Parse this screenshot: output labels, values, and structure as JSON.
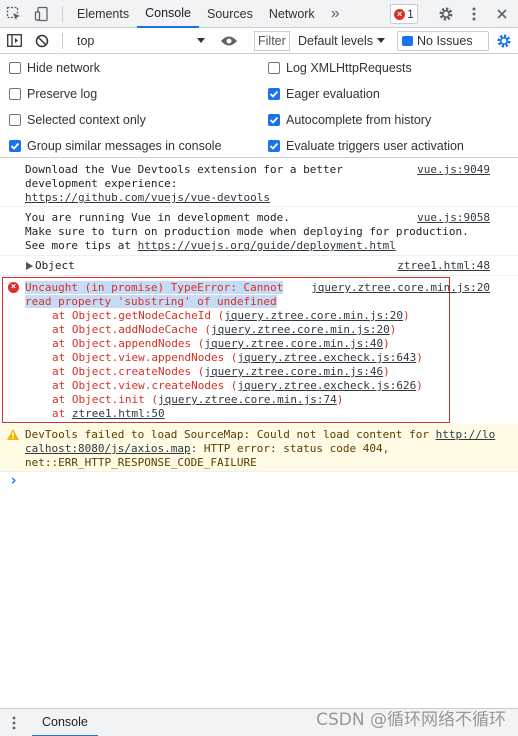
{
  "tabbar": {
    "tabs": [
      "Elements",
      "Console",
      "Sources",
      "Network"
    ],
    "more": "»",
    "error_count": "1"
  },
  "toolbar": {
    "context": "top",
    "filter_placeholder": "Filter",
    "levels": "Default levels",
    "issues": "No Issues"
  },
  "settings": {
    "hide_network": "Hide network",
    "preserve_log": "Preserve log",
    "selected_context": "Selected context only",
    "group_similar": "Group similar messages in console",
    "log_xhr": "Log XMLHttpRequests",
    "eager_eval": "Eager evaluation",
    "autocomplete": "Autocomplete from history",
    "eval_triggers": "Evaluate triggers user activation"
  },
  "messages": {
    "m1": {
      "line1": "Download the Vue Devtools extension for a better",
      "line2": "development experience:",
      "link": "https://github.com/vuejs/vue-devtools",
      "source": "vue.js:9049"
    },
    "m2": {
      "line1": "You are running Vue in development mode.",
      "line2": "Make sure to turn on production mode when deploying for production.",
      "line3_prefix": "See more tips at ",
      "link": "https://vuejs.org/guide/deployment.html",
      "source": "vue.js:9058"
    },
    "m3": {
      "text": "Object",
      "source": "ztree1.html:48"
    },
    "err": {
      "line1": "Uncaught (in promise) TypeError: Cannot",
      "line2": "read property 'substring' of undefined",
      "source": "jquery.ztree.core.min.js:20",
      "stack": [
        {
          "fn": "at Object.getNodeCacheId (",
          "loc": "jquery.ztree.core.min.js:20",
          "end": ")"
        },
        {
          "fn": "at Object.addNodeCache (",
          "loc": "jquery.ztree.core.min.js:20",
          "end": ")"
        },
        {
          "fn": "at Object.appendNodes (",
          "loc": "jquery.ztree.core.min.js:40",
          "end": ")"
        },
        {
          "fn": "at Object.view.appendNodes (",
          "loc": "jquery.ztree.excheck.js:643",
          "end": ")"
        },
        {
          "fn": "at Object.createNodes (",
          "loc": "jquery.ztree.core.min.js:46",
          "end": ")"
        },
        {
          "fn": "at Object.view.createNodes (",
          "loc": "jquery.ztree.excheck.js:626",
          "end": ")"
        },
        {
          "fn": "at Object.init (",
          "loc": "jquery.ztree.core.min.js:74",
          "end": ")"
        },
        {
          "fn": "at ",
          "loc": "ztree1.html:50",
          "end": ""
        }
      ]
    },
    "warn": {
      "line1_prefix": "DevTools failed to load SourceMap: Could not load content for ",
      "link1": "http://lo",
      "link2": "calhost:8080/js/axios.map",
      "line2_suffix": ": HTTP error: status code 404,",
      "line3": "net::ERR_HTTP_RESPONSE_CODE_FAILURE"
    }
  },
  "prompt": "›",
  "drawer": {
    "tab": "Console"
  },
  "watermark": "CSDN @循环网络不循环"
}
